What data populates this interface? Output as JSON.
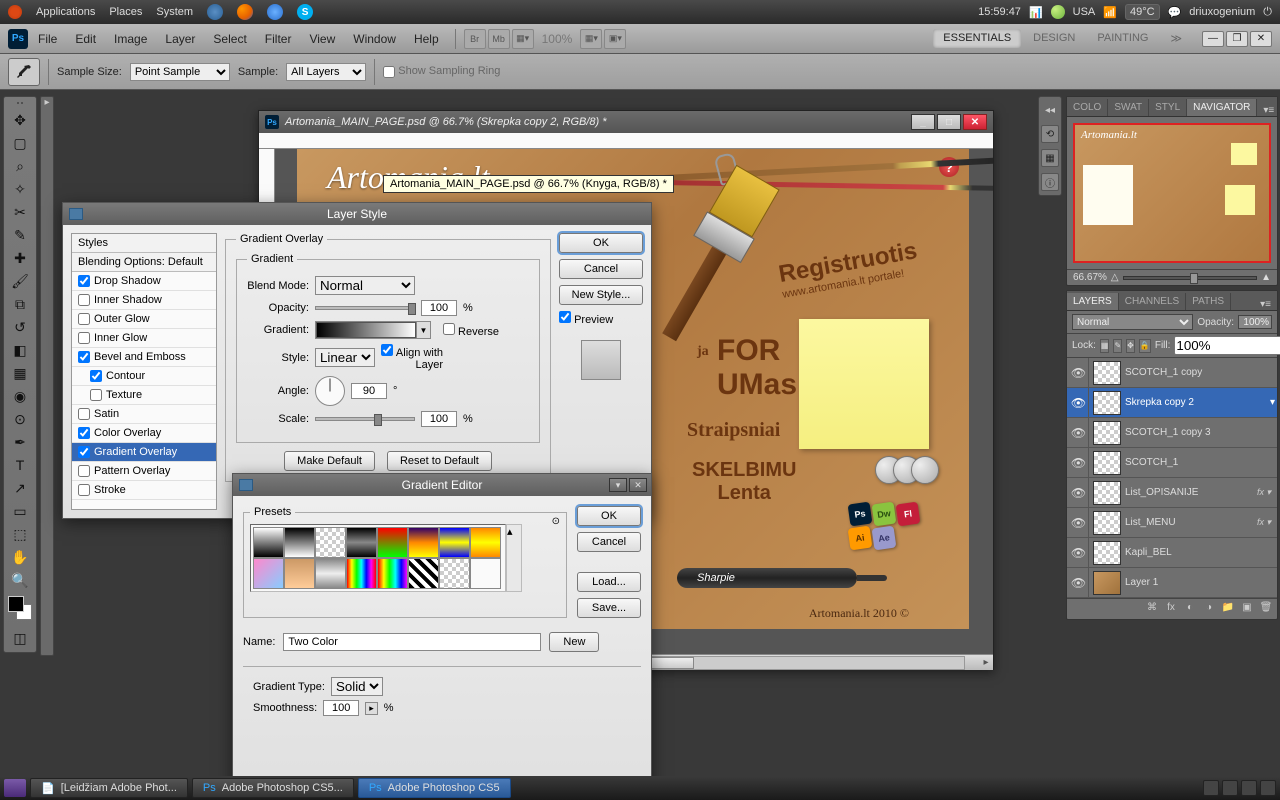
{
  "sysbar": {
    "apps": "Applications",
    "places": "Places",
    "system": "System",
    "time": "15:59:47",
    "lang": "USA",
    "temp": "49°C",
    "user": "driuxogenium"
  },
  "menubar": {
    "items": [
      "File",
      "Edit",
      "Image",
      "Layer",
      "Select",
      "Filter",
      "View",
      "Window",
      "Help"
    ],
    "br": "Br",
    "mb": "Mb",
    "zoom": "100%",
    "workspaces": {
      "essentials": "ESSENTIALS",
      "design": "DESIGN",
      "painting": "PAINTING"
    }
  },
  "optbar": {
    "sample_size_label": "Sample Size:",
    "sample_size": "Point Sample",
    "sample_label": "Sample:",
    "sample": "All Layers",
    "show_ring": "Show Sampling Ring"
  },
  "docwin": {
    "title": "Artomania_MAIN_PAGE.psd @ 66.7% (Skrepka copy 2, RGB/8) *",
    "tooltip": "Artomania_MAIN_PAGE.psd @ 66.7% (Knyga, RGB/8) *",
    "art": {
      "title": "Artomania.lt",
      "register": "Registruotis",
      "register_sub": "www.artomania.lt portale!",
      "forum": "FOR",
      "forum2": "UMas",
      "ja": "ja",
      "straipsniai": "Straipsniai",
      "skelbimu": "SKELBIMU",
      "lenta": "Lenta",
      "sharpie": "Sharpie",
      "footer": "Artomania.lt 2010 ©"
    }
  },
  "layerstyle": {
    "title": "Layer Style",
    "styles_hdr": "Styles",
    "blending_hdr": "Blending Options: Default",
    "rows": {
      "drop_shadow": "Drop Shadow",
      "inner_shadow": "Inner Shadow",
      "outer_glow": "Outer Glow",
      "inner_glow": "Inner Glow",
      "bevel": "Bevel and Emboss",
      "contour": "Contour",
      "texture": "Texture",
      "satin": "Satin",
      "color_overlay": "Color Overlay",
      "gradient_overlay": "Gradient Overlay",
      "pattern_overlay": "Pattern Overlay",
      "stroke": "Stroke"
    },
    "legend": "Gradient Overlay",
    "sublegend": "Gradient",
    "blend_mode": "Blend Mode:",
    "blend_mode_val": "Normal",
    "opacity": "Opacity:",
    "opacity_val": "100",
    "gradient": "Gradient:",
    "reverse": "Reverse",
    "style": "Style:",
    "style_val": "Linear",
    "align": "Align with Layer",
    "angle": "Angle:",
    "angle_val": "90",
    "scale": "Scale:",
    "scale_val": "100",
    "make_default": "Make Default",
    "reset_default": "Reset to Default",
    "ok": "OK",
    "cancel": "Cancel",
    "new_style": "New Style...",
    "preview": "Preview"
  },
  "gradedit": {
    "title": "Gradient Editor",
    "presets": "Presets",
    "name_label": "Name:",
    "name": "Two Color",
    "type_label": "Gradient Type:",
    "type": "Solid",
    "smoothness_label": "Smoothness:",
    "smoothness": "100",
    "ok": "OK",
    "cancel": "Cancel",
    "load": "Load...",
    "save": "Save...",
    "new": "New"
  },
  "rightpanels": {
    "tabs_top": {
      "color": "COLO",
      "swatches": "SWAT",
      "styles": "STYL",
      "nav": "NAVIGATOR"
    },
    "nav_zoom": "66.67%",
    "tabs_layer": {
      "layers": "LAYERS",
      "channels": "CHANNELS",
      "paths": "PATHS"
    },
    "normal": "Normal",
    "opacity_label": "Opacity:",
    "opacity": "100%",
    "lock": "Lock:",
    "fill_label": "Fill:",
    "fill": "100%",
    "layers": [
      {
        "name": "SCOTCH_1 copy",
        "fx": ""
      },
      {
        "name": "Skrepka copy 2",
        "fx": ""
      },
      {
        "name": "SCOTCH_1 copy 3",
        "fx": ""
      },
      {
        "name": "SCOTCH_1",
        "fx": ""
      },
      {
        "name": "List_OPISANIJE",
        "fx": "fx ▾"
      },
      {
        "name": "List_MENU",
        "fx": "fx ▾"
      },
      {
        "name": "Kapli_BEL",
        "fx": ""
      },
      {
        "name": "Layer 1",
        "fx": ""
      }
    ]
  },
  "taskbar": {
    "t1": "[Leidžiam Adobe Phot...",
    "t2": "Adobe Photoshop CS5...",
    "t3": "Adobe Photoshop CS5"
  }
}
